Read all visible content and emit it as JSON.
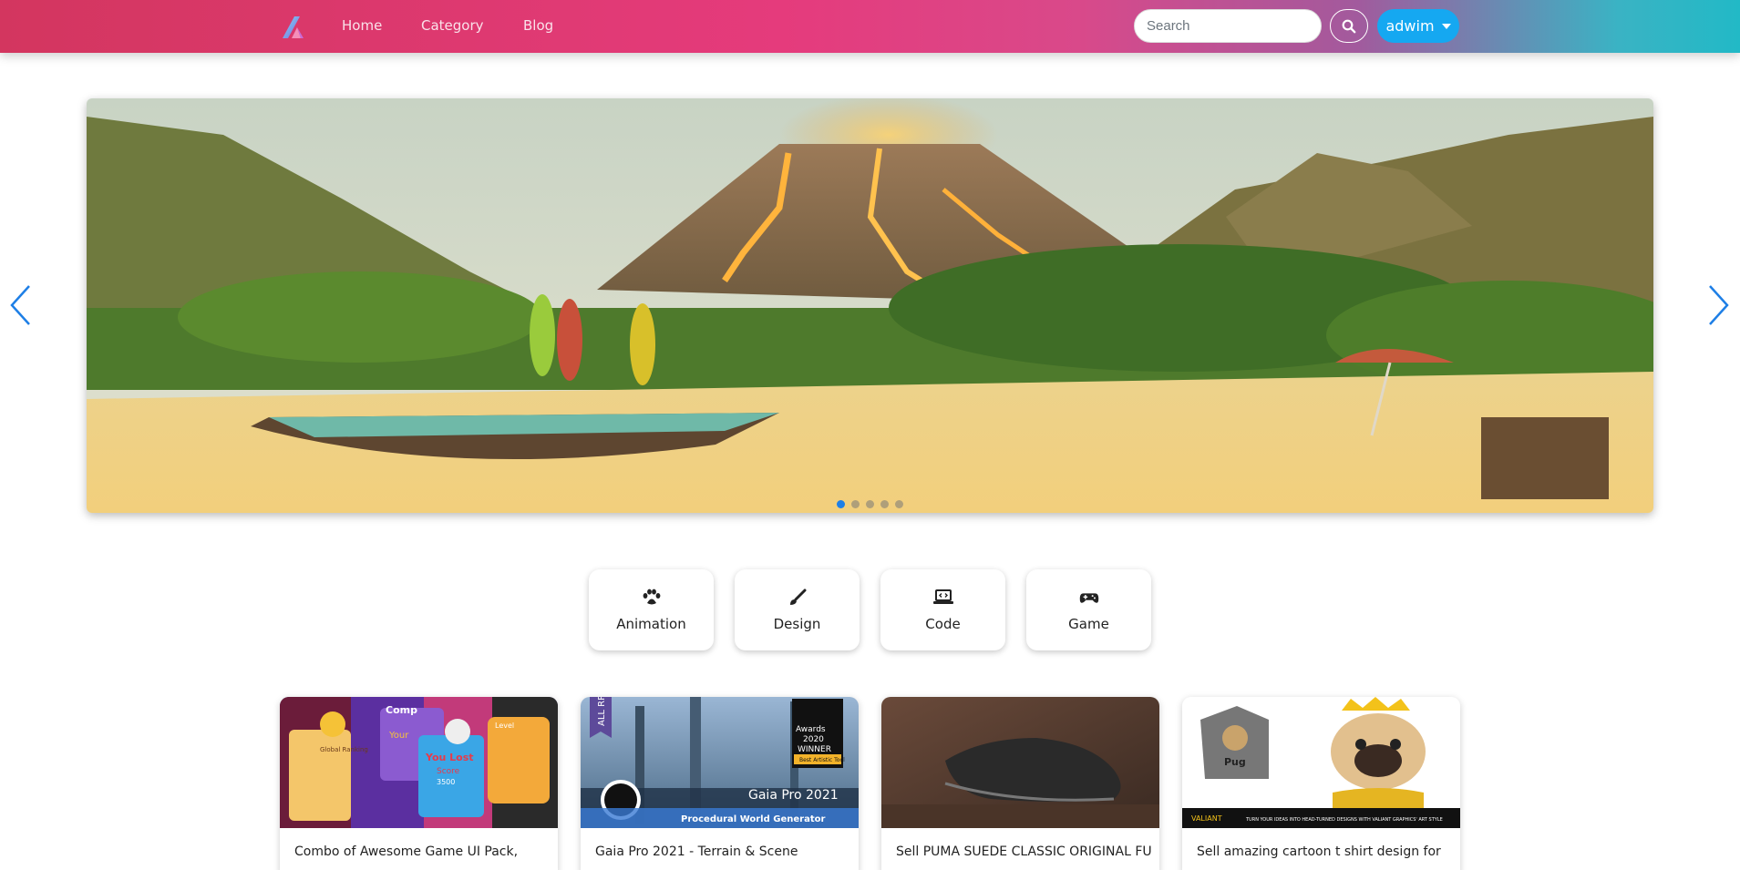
{
  "navbar": {
    "links": [
      {
        "label": "Home"
      },
      {
        "label": "Category"
      },
      {
        "label": "Blog"
      }
    ],
    "search": {
      "placeholder": "Search",
      "value": ""
    },
    "user": {
      "label": "adwim"
    }
  },
  "carousel": {
    "slide_count": 5,
    "active_index": 0
  },
  "categories": [
    {
      "label": "Animation",
      "icon": "paw-icon"
    },
    {
      "label": "Design",
      "icon": "paintbrush-icon"
    },
    {
      "label": "Code",
      "icon": "laptop-code-icon"
    },
    {
      "label": "Game",
      "icon": "gamepad-icon"
    }
  ],
  "products": [
    {
      "title": "Combo of Awesome Game UI Pack,",
      "thumb_text": [
        "Global Ranking",
        "Comp",
        "Your",
        "You Lost",
        "Score",
        "3500",
        "Level"
      ]
    },
    {
      "title": "Gaia Pro 2021 - Terrain & Scene",
      "thumb_text": [
        "ALL RP",
        "Awards",
        "2020",
        "WINNER",
        "Best Artistic Tool",
        "Gaia Pro 2021",
        "Procedural World Generator"
      ]
    },
    {
      "title": "Sell PUMA SUEDE CLASSIC ORIGINAL FULL",
      "thumb_text": []
    },
    {
      "title": "Sell amazing cartoon t shirt design for",
      "thumb_text": [
        "Pug",
        "VALIANT",
        "TURN YOUR IDEAS INTO HEAD-TURNED DESIGNS WITH VALIANT GRAPHICS' ART STYLE"
      ]
    }
  ],
  "colors": {
    "brand_pink": "#e53b7c",
    "brand_teal": "#22b9c6",
    "user_button": "#15a8f1",
    "active_indicator": "#1e7fe6",
    "arrow": "#1e7fe6"
  }
}
